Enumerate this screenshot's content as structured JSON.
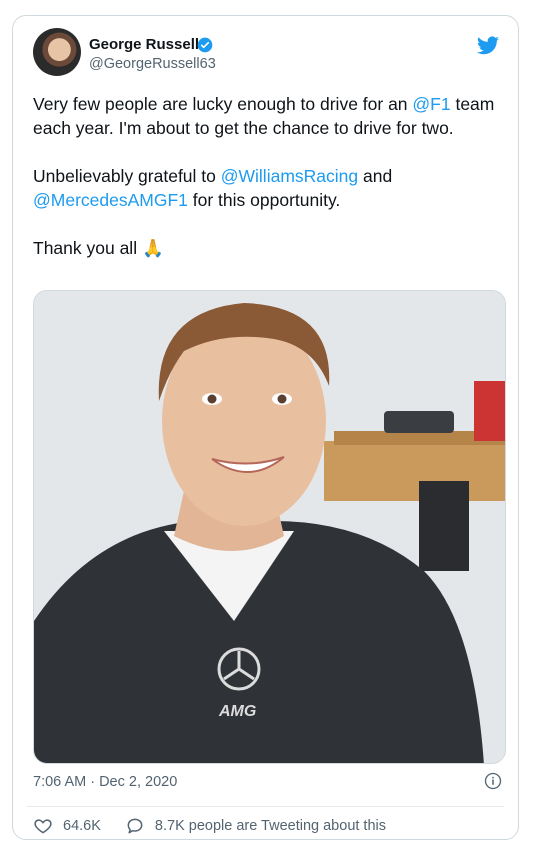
{
  "author": {
    "name": "George Russell",
    "handle": "@GeorgeRussell63"
  },
  "tweet": {
    "line1_prefix": "Very few people are lucky enough to drive for an ",
    "mention_f1": "@F1",
    "line1_suffix": " team each year. I'm about to get the chance to drive for two.",
    "line2_prefix": "Unbelievably grateful to ",
    "mention_williams": "@WilliamsRacing",
    "line2_mid": " and ",
    "mention_mercedes": "@MercedesAMGF1",
    "line2_suffix": " for this opportunity.",
    "line3": "Thank you all 🙏"
  },
  "timestamp": "7:06 AM · Dec 2, 2020",
  "likes": "64.6K",
  "tweeting": "8.7K people are Tweeting about this",
  "colors": {
    "accent": "#1d9bf0",
    "text": "#0f1419",
    "muted": "#536471"
  }
}
